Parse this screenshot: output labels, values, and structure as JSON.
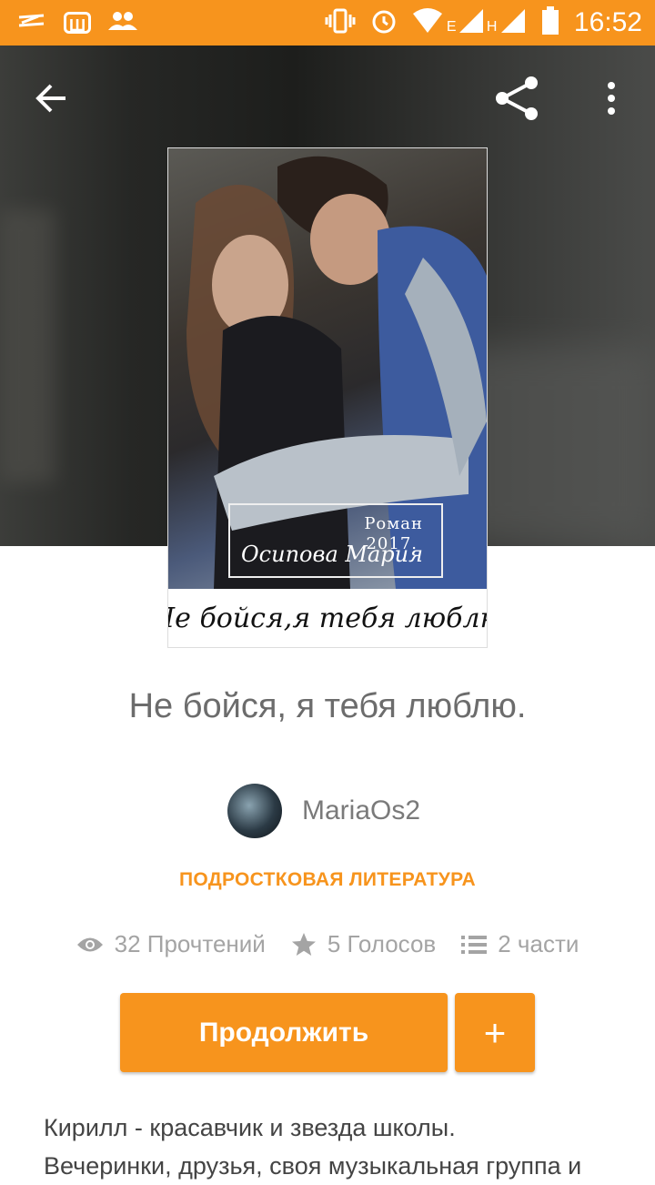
{
  "status_bar": {
    "time": "16:52",
    "network_1": "E",
    "network_2": "H"
  },
  "cover": {
    "genre_label": "Роман",
    "year": "2017.",
    "author": "Осипова Мария",
    "caption": "Не бойся,я тебя люблю"
  },
  "story": {
    "title": "Не бойся, я тебя люблю.",
    "author_name": "MariaOs2",
    "genre": "ПОДРОСТКОВАЯ ЛИТЕРАТУРА",
    "reads": "32 Прочтений",
    "votes": "5 Голосов",
    "parts": "2 части",
    "description_line1": "Кирилл - красавчик и звезда школы.",
    "description_line2": "Вечеринки, друзья, своя музыкальная группа и"
  },
  "actions": {
    "continue_label": "Продолжить",
    "add_label": "+"
  },
  "colors": {
    "accent": "#f7941d",
    "text_muted": "#a4a4a4"
  }
}
